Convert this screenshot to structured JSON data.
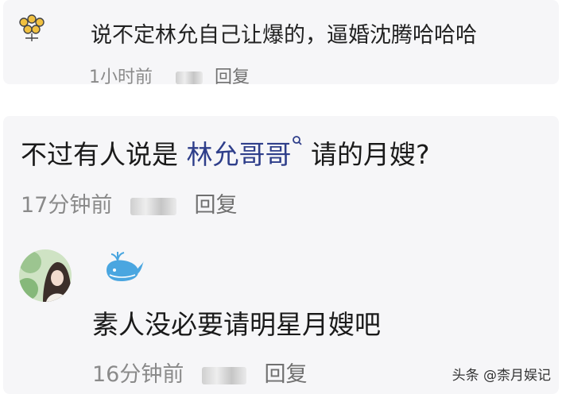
{
  "comment1": {
    "text": "说不定林允自己让爆的，逼婚沈腾哈哈哈",
    "time": "1小时前",
    "reply": "回复"
  },
  "comment2": {
    "text_before": "不过有人说是 ",
    "highlight": "林允哥哥",
    "text_after": " 请的月嫂?",
    "time": "17分钟前",
    "reply": "回复"
  },
  "reply1": {
    "badge_icon": "whale-icon",
    "text": "素人没必要请明星月嫂吧",
    "time": "16分钟前",
    "reply": "回复"
  },
  "watermark": "头条 @柰月娱记",
  "colors": {
    "highlight": "#2e3e8a",
    "card_bg": "#f6f6f8",
    "meta": "#8a8a8a",
    "whale": "#4aa6e0"
  }
}
